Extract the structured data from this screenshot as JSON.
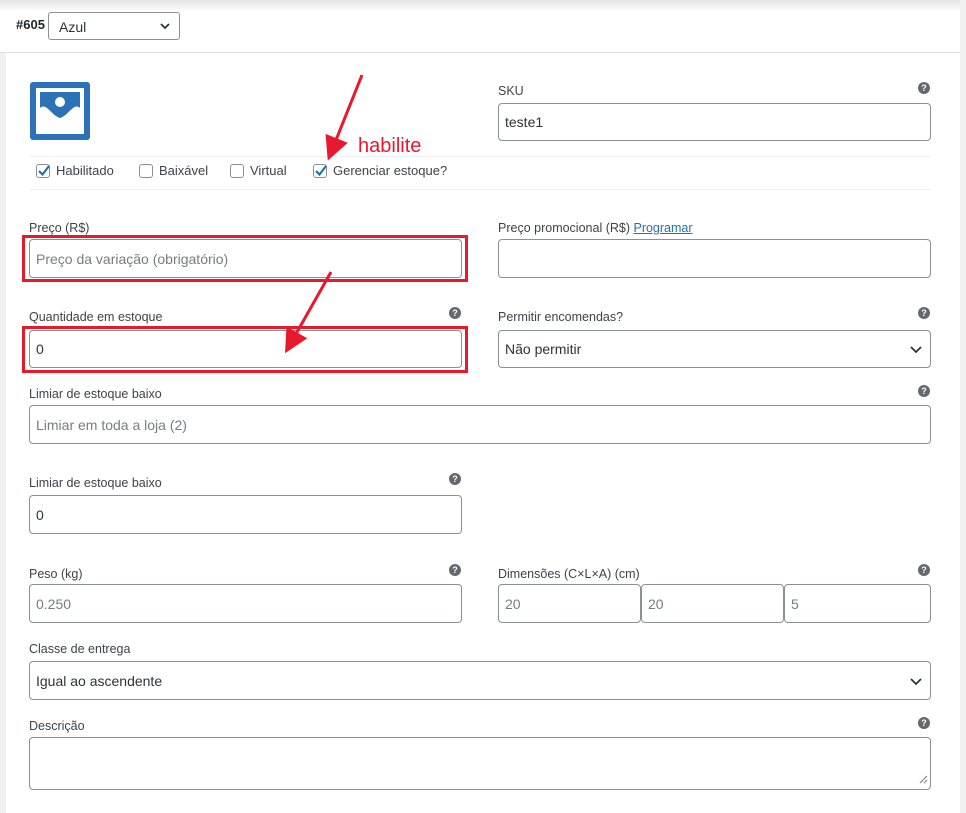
{
  "header": {
    "variation_id": "#605",
    "variation_value": "Azul"
  },
  "sku": {
    "label": "SKU",
    "value": "teste1"
  },
  "options": [
    {
      "label": "Habilitado",
      "checked": true
    },
    {
      "label": "Baixável",
      "checked": false
    },
    {
      "label": "Virtual",
      "checked": false
    },
    {
      "label": "Gerenciar estoque?",
      "checked": true
    }
  ],
  "annotation": {
    "text": "habilite",
    "color": "#e8182f"
  },
  "price": {
    "label": "Preço (R$)",
    "placeholder": "Preço da variação (obrigatório)"
  },
  "sale_price": {
    "label": "Preço promocional (R$)",
    "link": "Programar",
    "value": ""
  },
  "stock_qty": {
    "label": "Quantidade em estoque",
    "value": "0"
  },
  "backorders": {
    "label": "Permitir encomendas?",
    "value": "Não permitir"
  },
  "low_stock_1": {
    "label": "Limiar de estoque baixo",
    "placeholder": "Limiar em toda a loja (2)"
  },
  "low_stock_2": {
    "label": "Limiar de estoque baixo",
    "value": "0"
  },
  "weight": {
    "label": "Peso (kg)",
    "placeholder": "0.250"
  },
  "dimensions": {
    "label": "Dimensões (C×L×A) (cm)",
    "length": "20",
    "width": "20",
    "height": "5"
  },
  "shipping_class": {
    "label": "Classe de entrega",
    "value": "Igual ao ascendente"
  },
  "description": {
    "label": "Descrição",
    "value": ""
  },
  "help_symbol": "?",
  "colors": {
    "accent": "#2271b1",
    "highlight": "#e51b2a"
  }
}
